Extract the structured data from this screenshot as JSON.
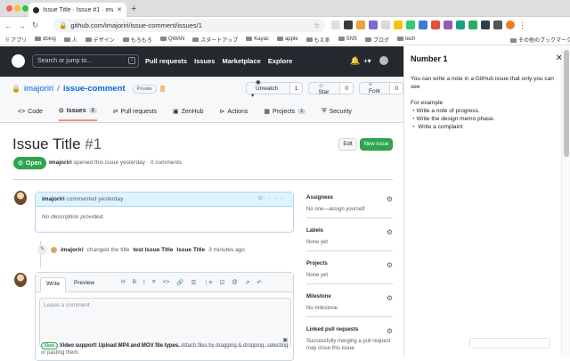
{
  "browser": {
    "tab_title": "Issue Title · Issue #1 · imajoririri",
    "url": "github.com/imajoriri/issue-comment/issues/1",
    "bookmarks": [
      "アプリ",
      "doing",
      "人",
      "デザイン",
      "もろもろ",
      "QWAN",
      "スタートアップ",
      "Kayac",
      "apple",
      "もえ系",
      "SNS",
      "ブログ",
      "tech"
    ],
    "other_bookmarks": "その他のブックマーク"
  },
  "header": {
    "search_placeholder": "Search or jump to...",
    "slash": "/",
    "nav": [
      "Pull requests",
      "Issues",
      "Marketplace",
      "Explore"
    ],
    "plus": "+▾"
  },
  "repo": {
    "owner": "imajoriri",
    "separator": "/",
    "name": "issue-comment",
    "visibility": "Private",
    "watch_label": "Unwatch ▾",
    "watch_count": "1",
    "star_label": "Star",
    "star_count": "0",
    "fork_label": "Fork",
    "fork_count": "0",
    "tabs": [
      {
        "label": "Code"
      },
      {
        "label": "Issues",
        "count": "1"
      },
      {
        "label": "Pull requests"
      },
      {
        "label": "ZenHub"
      },
      {
        "label": "Actions"
      },
      {
        "label": "Projects",
        "count": "1"
      },
      {
        "label": "Security"
      }
    ]
  },
  "issue": {
    "title": "Issue Title",
    "number": "#1",
    "edit": "Edit",
    "new_issue": "New issue",
    "state": "Open",
    "author": "imajoriri",
    "meta_rest": "opened this issue yesterday · 0 comments",
    "comment_author": "imajoriri",
    "comment_time": "commented yesterday",
    "comment_body": "No description provided.",
    "event_author": "imajoriri",
    "event_text": "changed the title",
    "event_old": "test Issue Title",
    "event_time": "3 minutes ago"
  },
  "editor": {
    "write": "Write",
    "preview": "Preview",
    "tools": [
      "H",
      "B",
      "I",
      "≡",
      "<>",
      "🔗",
      "☰",
      "⋮≡",
      "☑",
      "@",
      "↗",
      "↶"
    ],
    "placeholder": "Leave a comment",
    "new_badge": "New",
    "notice_bold": "Video support! Upload MP4 and MOV file types.",
    "notice_rest": "Attach files by dragging & dropping, selecting or pasting them."
  },
  "sidebar": [
    {
      "heading": "Assignees",
      "value": "No one—assign yourself"
    },
    {
      "heading": "Labels",
      "value": "None yet"
    },
    {
      "heading": "Projects",
      "value": "None yet"
    },
    {
      "heading": "Milestone",
      "value": "No milestone"
    },
    {
      "heading": "Linked pull requests",
      "value": "Successfully merging a pull request may close this issue."
    }
  ],
  "panel": {
    "title": "Number 1",
    "close": "✕",
    "intro": "You can write a note in a GitHub issue that only you can see",
    "example_heading": "For example",
    "examples": [
      "・Write a note of progress.",
      "・Write the design memo phase.",
      "・ Write a complaint"
    ]
  },
  "colors": {
    "github_dark": "#24292f",
    "open_green": "#2da44e",
    "link_blue": "#0969da"
  }
}
